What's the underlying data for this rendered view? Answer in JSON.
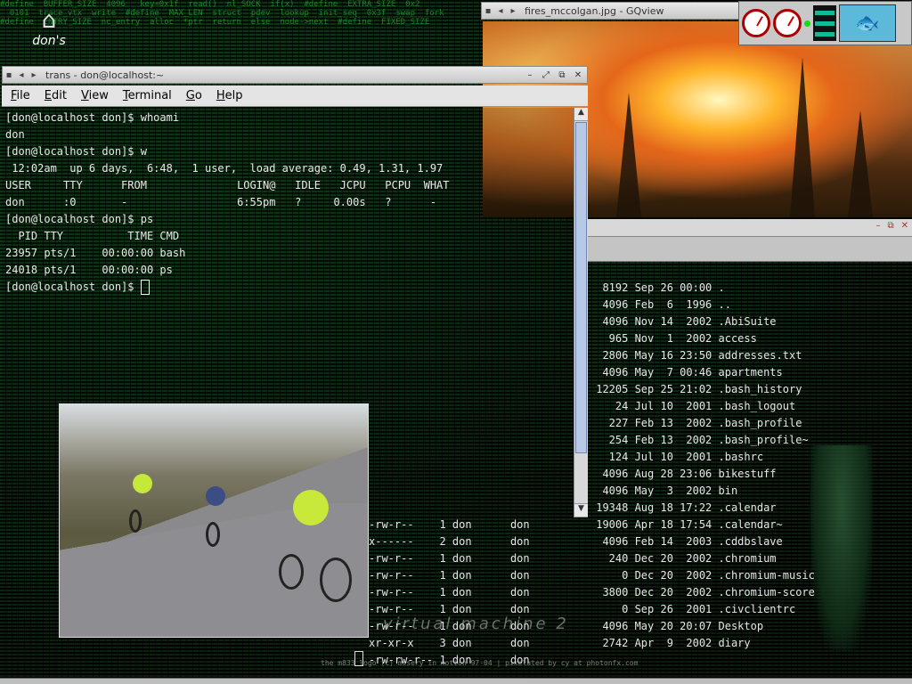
{
  "desktop": {
    "icon_label": "don's",
    "watermark": "virtual machine 2",
    "credit": "the m833 logo (c) misery in motion 97-04 | pixelated by cy at photonfx.com"
  },
  "terminal": {
    "title": "trans - don@localhost:~",
    "menu": [
      "File",
      "Edit",
      "View",
      "Terminal",
      "Go",
      "Help"
    ],
    "lines": [
      "[don@localhost don]$ whoami",
      "don",
      "[don@localhost don]$ w",
      " 12:02am  up 6 days,  6:48,  1 user,  load average: 0.49, 1.31, 1.97",
      "USER     TTY      FROM              LOGIN@   IDLE   JCPU   PCPU  WHAT",
      "don      :0       -                 6:55pm   ?     0.00s   ?      -",
      "[don@localhost don]$ ps",
      "  PID TTY          TIME CMD",
      "23957 pts/1    00:00:00 bash",
      "24018 pts/1    00:00:00 ps",
      "[don@localhost don]$ "
    ]
  },
  "gqview": {
    "title": "fires_mccolgan.jpg - GQview"
  },
  "ls_listing": [
    "  8192 Sep 26 00:00 .",
    "  4096 Feb  6  1996 ..",
    "  4096 Nov 14  2002 .AbiSuite",
    "   965 Nov  1  2002 access",
    "  2806 May 16 23:50 addresses.txt",
    "  4096 May  7 00:46 apartments",
    " 12205 Sep 25 21:02 .bash_history",
    "    24 Jul 10  2001 .bash_logout",
    "   227 Feb 13  2002 .bash_profile",
    "   254 Feb 13  2002 .bash_profile~",
    "   124 Jul 10  2001 .bashrc",
    "  4096 Aug 28 23:06 bikestuff",
    "  4096 May  3  2002 bin",
    " 19348 Aug 18 17:22 .calendar",
    " 19006 Apr 18 17:54 .calendar~",
    "  4096 Feb 14  2003 .cddbslave",
    "   240 Dec 20  2002 .chromium",
    "     0 Dec 20  2002 .chromium-music",
    "  3800 Dec 20  2002 .chromium-score",
    "     0 Sep 26  2001 .civclientrc",
    "  4096 May 20 20:07 Desktop",
    "  2742 Apr  9  2002 diary"
  ],
  "perm_listing": [
    "-rw-r--    1 don      don",
    "x------    2 don      don",
    "-rw-r--    1 don      don",
    "-rw-r--    1 don      don",
    "-rw-r--    1 don      don",
    "-rw-r--    1 don      don",
    "-rw-r--    1 don      don",
    "xr-xr-x    3 don      don",
    "-rw-rw-r-- 1 don      don"
  ]
}
